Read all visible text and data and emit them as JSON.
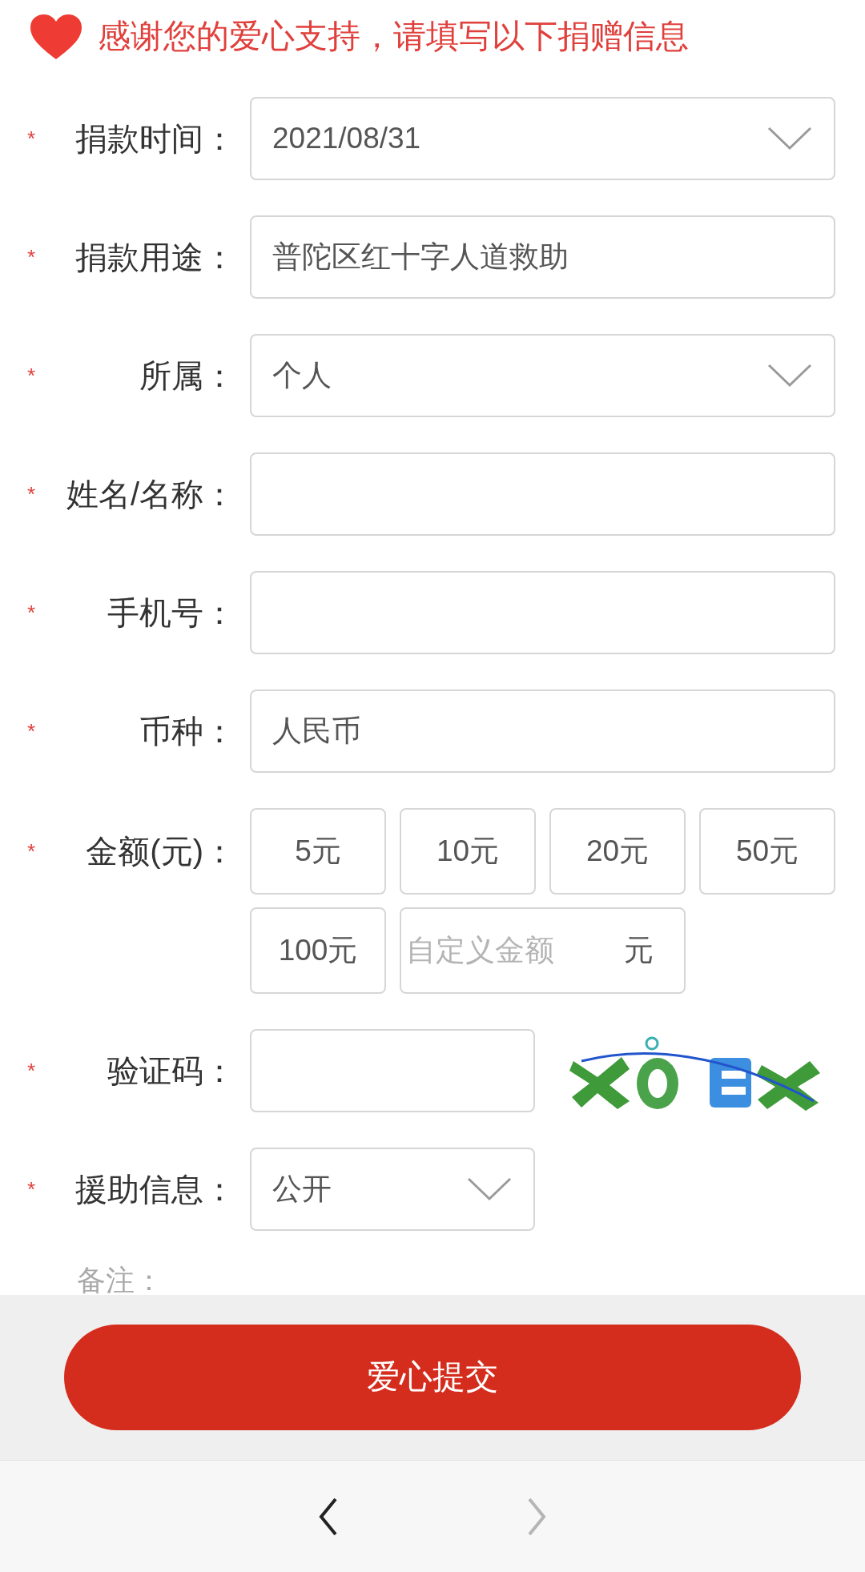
{
  "header": {
    "text": "感谢您的爱心支持，请填写以下捐赠信息"
  },
  "fields": [
    {
      "label": "捐款时间：",
      "marker": "*",
      "kind": "select",
      "value": "2021/08/31"
    },
    {
      "label": "捐款用途：",
      "marker": "*",
      "kind": "text",
      "value": "普陀区红十字人道救助"
    },
    {
      "label": "所属：",
      "marker": "*",
      "kind": "select",
      "value": "个人"
    },
    {
      "label": "姓名/名称：",
      "marker": "*",
      "kind": "text"
    },
    {
      "label": "手机号：",
      "marker": "*",
      "kind": "text"
    },
    {
      "label": "币种：",
      "marker": "*",
      "kind": "text",
      "value": "人民币"
    },
    {
      "label": "金额(元)：",
      "marker": "*",
      "kind": "amounts",
      "options": [
        "5元",
        "10元",
        "20元",
        "50元",
        "100元"
      ],
      "custom": {
        "placeholder": "自定义金额",
        "unit": "元"
      }
    },
    {
      "label": "验证码：",
      "marker": "*",
      "kind": "captcha"
    },
    {
      "label": "援助信息：",
      "marker": "*",
      "kind": "short_select",
      "value": "公开"
    }
  ],
  "note": {
    "label": "备注："
  },
  "submit_button": "爱心提交",
  "nav": [
    {
      "kind": "back",
      "disabled": false
    },
    {
      "kind": "forward",
      "disabled": true
    }
  ]
}
